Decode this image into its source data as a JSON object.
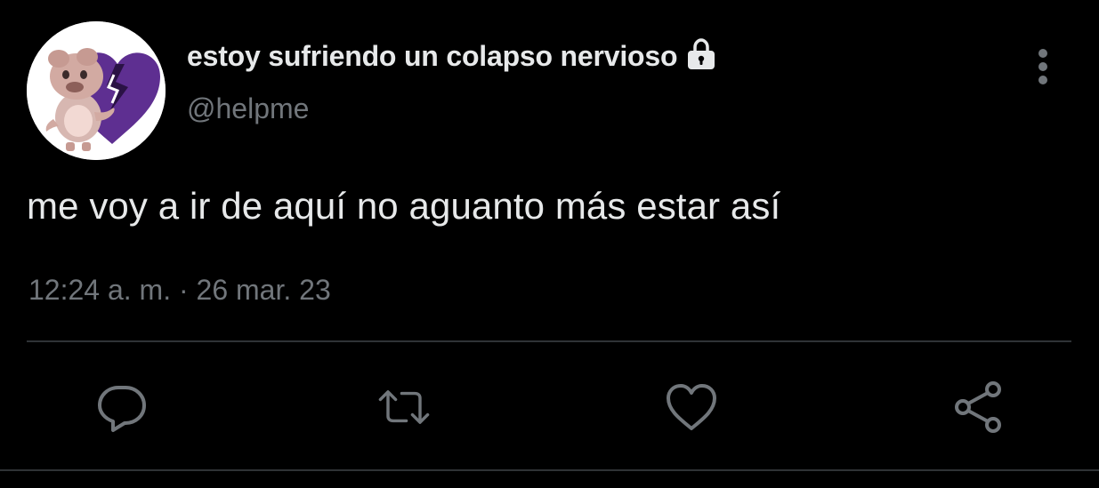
{
  "tweet": {
    "display_name": "estoy sufriendo un colapso nervioso",
    "handle": "@helpme",
    "text": "me voy a ir de aquí no aguanto más estar así",
    "timestamp": "12:24 a. m. · 26 mar. 23",
    "protected_icon": "lock-icon",
    "avatar": "avatar-image"
  },
  "actions": {
    "reply_icon": "reply-icon",
    "retweet_icon": "retweet-icon",
    "like_icon": "heart-icon",
    "share_icon": "share-icon",
    "more_icon": "more-vertical-icon"
  },
  "colors": {
    "background": "#000000",
    "primary_text": "#e7e9ea",
    "secondary_text": "#71767b",
    "divider": "#2f3336",
    "avatar_accent": "#6a3b9a"
  }
}
